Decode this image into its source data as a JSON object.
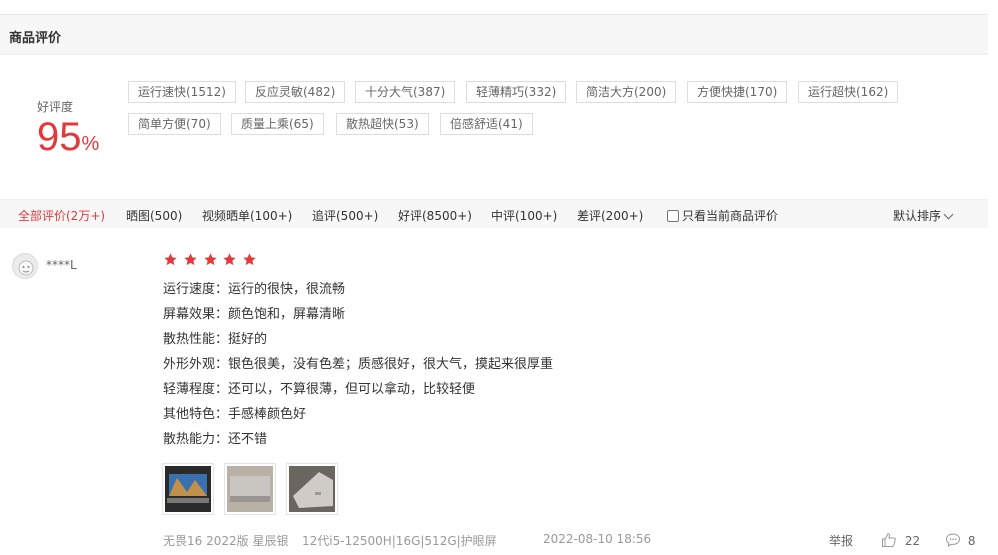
{
  "section": {
    "title": "商品评价"
  },
  "rating": {
    "label": "好评度",
    "value": "95",
    "unit": "%"
  },
  "tags": [
    "运行速快(1512)",
    "反应灵敏(482)",
    "十分大气(387)",
    "轻薄精巧(332)",
    "简洁大方(200)",
    "方便快捷(170)",
    "运行超快(162)",
    "简单方便(70)",
    "质量上乘(65)",
    "散热超快(53)",
    "倍感舒适(41)"
  ],
  "filters": {
    "items": [
      "全部评价(2万+)",
      "晒图(500)",
      "视频晒单(100+)",
      "追评(500+)",
      "好评(8500+)",
      "中评(100+)",
      "差评(200+)"
    ],
    "only_current_label": "只看当前商品评价",
    "sort_label": "默认排序"
  },
  "review": {
    "username": "****L",
    "stars": 5,
    "lines": [
      "运行速度：运行的很快，很流畅",
      "屏幕效果：颜色饱和，屏幕清晰",
      "散热性能：挺好的",
      "外形外观：银色很美，没有色差；质感很好，很大气，摸起来很厚重",
      "轻薄程度：还可以，不算很薄，但可以拿动，比较轻便",
      "其他特色：手感棒颜色好",
      "散热能力：还不错"
    ],
    "product_variant": "无畏16 2022版 星辰银",
    "spec": "12代i5-12500H|16G|512G|护眼屏",
    "date": "2022-08-10 18:56",
    "report_label": "举报",
    "like_count": "22",
    "comment_count": "8"
  },
  "colors": {
    "accent": "#e4393c",
    "panel": "#f7f7f7"
  }
}
